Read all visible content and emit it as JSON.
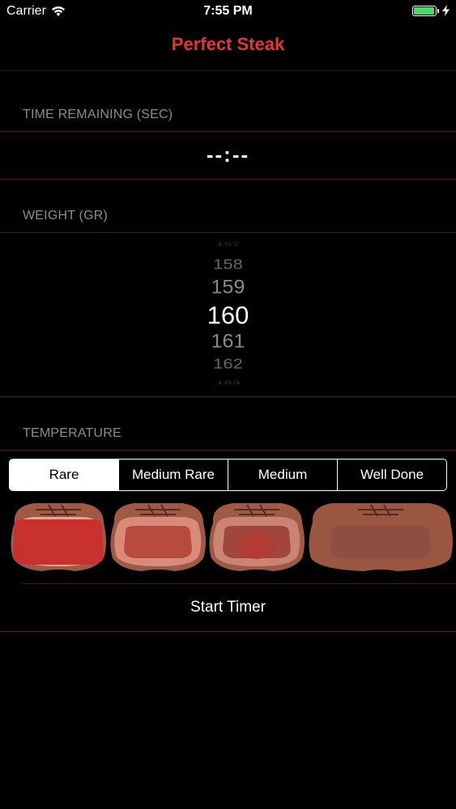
{
  "status_bar": {
    "carrier": "Carrier",
    "time": "7:55 PM",
    "battery_level": 1.0
  },
  "nav": {
    "title": "Perfect Steak"
  },
  "time_section": {
    "header": "TIME REMAINING (SEC)",
    "value": "--:--"
  },
  "weight_section": {
    "header": "WEIGHT (GR)",
    "picker_values": [
      "157",
      "158",
      "159",
      "160",
      "161",
      "162",
      "163"
    ],
    "selected_value": "160"
  },
  "temperature_section": {
    "header": "TEMPERATURE",
    "options": [
      "Rare",
      "Medium Rare",
      "Medium",
      "Well Done"
    ],
    "selected_index": 0
  },
  "steaks": [
    {
      "name": "rare",
      "crust": "#9e5a44",
      "ring": "#e8a592",
      "core": "#c8312e"
    },
    {
      "name": "medium-rare",
      "crust": "#9e5a44",
      "ring": "#d98a78",
      "core": "#b74c3d"
    },
    {
      "name": "medium",
      "crust": "#9e5a44",
      "ring": "#c98571",
      "core": "#a0463a"
    },
    {
      "name": "well-done",
      "crust": "#9a5640",
      "ring": "#9a5640",
      "core": "#8d5040"
    }
  ],
  "actions": {
    "start_timer": "Start Timer"
  },
  "colors": {
    "accent": "#e5372b",
    "separator": "#5a1a14",
    "header_text": "#8c8c8c"
  }
}
